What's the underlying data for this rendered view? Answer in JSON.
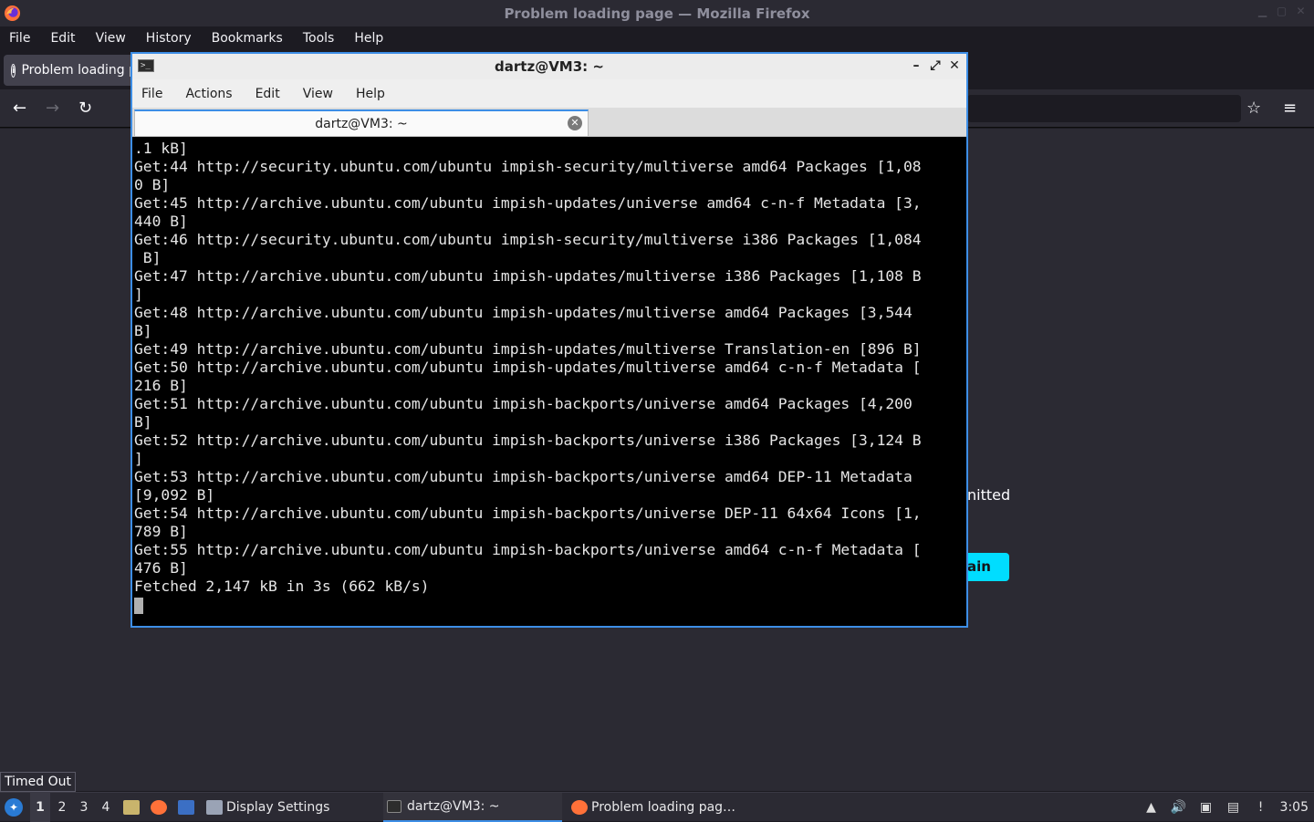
{
  "firefox": {
    "window_title": "Problem loading page — Mozilla Firefox",
    "menu": [
      "File",
      "Edit",
      "View",
      "History",
      "Bookmarks",
      "Tools",
      "Help"
    ],
    "tab_title": "Problem loading page",
    "partial_error_text": "nitted",
    "partial_button_label": "ain",
    "status_tooltip": "Timed Out",
    "accent_color": "#00ddff"
  },
  "terminal": {
    "window_title": "dartz@VM3: ~",
    "menu": [
      "File",
      "Actions",
      "Edit",
      "View",
      "Help"
    ],
    "tab_title": "dartz@VM3: ~",
    "lines": [
      ".1 kB]",
      "Get:44 http://security.ubuntu.com/ubuntu impish-security/multiverse amd64 Packages [1,08",
      "0 B]",
      "Get:45 http://archive.ubuntu.com/ubuntu impish-updates/universe amd64 c-n-f Metadata [3,",
      "440 B]",
      "Get:46 http://security.ubuntu.com/ubuntu impish-security/multiverse i386 Packages [1,084",
      " B]",
      "Get:47 http://archive.ubuntu.com/ubuntu impish-updates/multiverse i386 Packages [1,108 B",
      "]",
      "Get:48 http://archive.ubuntu.com/ubuntu impish-updates/multiverse amd64 Packages [3,544",
      "B]",
      "Get:49 http://archive.ubuntu.com/ubuntu impish-updates/multiverse Translation-en [896 B]",
      "Get:50 http://archive.ubuntu.com/ubuntu impish-updates/multiverse amd64 c-n-f Metadata [",
      "216 B]",
      "Get:51 http://archive.ubuntu.com/ubuntu impish-backports/universe amd64 Packages [4,200",
      "B]",
      "Get:52 http://archive.ubuntu.com/ubuntu impish-backports/universe i386 Packages [3,124 B",
      "]",
      "Get:53 http://archive.ubuntu.com/ubuntu impish-backports/universe amd64 DEP-11 Metadata",
      "[9,092 B]",
      "Get:54 http://archive.ubuntu.com/ubuntu impish-backports/universe DEP-11 64x64 Icons [1,",
      "789 B]",
      "Get:55 http://archive.ubuntu.com/ubuntu impish-backports/universe amd64 c-n-f Metadata [",
      "476 B]",
      "Fetched 2,147 kB in 3s (662 kB/s)"
    ],
    "accent_color": "#3d8ee6"
  },
  "taskbar": {
    "workspaces": [
      "1",
      "2",
      "3",
      "4"
    ],
    "active_workspace": "1",
    "tasks": [
      {
        "label": "Display Settings",
        "icon": "display-settings-icon"
      },
      {
        "label": "dartz@VM3: ~",
        "icon": "terminal-icon"
      },
      {
        "label": "Problem loading pag…",
        "icon": "firefox-icon"
      }
    ],
    "clock": "3:05"
  }
}
